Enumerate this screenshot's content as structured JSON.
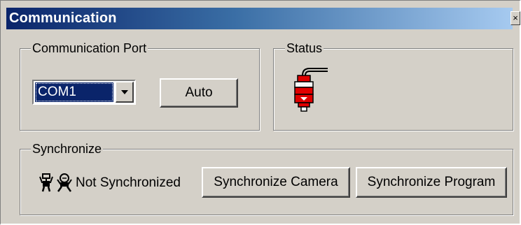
{
  "window": {
    "title": "Communication",
    "close_glyph": "×"
  },
  "comm_port": {
    "legend": "Communication Port",
    "selected": "COM1",
    "auto_label": "Auto"
  },
  "status": {
    "legend": "Status",
    "icon": "camera-plug-icon"
  },
  "synchronize": {
    "legend": "Synchronize",
    "icons": [
      "robot-icon",
      "robot-head-icon"
    ],
    "state_text": "Not Synchronized",
    "camera_button": "Synchronize Camera",
    "program_button": "Synchronize Program"
  },
  "colors": {
    "face": "#d4d0c8",
    "title_start": "#0a246a",
    "title_end": "#a6caf0",
    "selection": "#0a246a",
    "status_red": "#e00000"
  }
}
